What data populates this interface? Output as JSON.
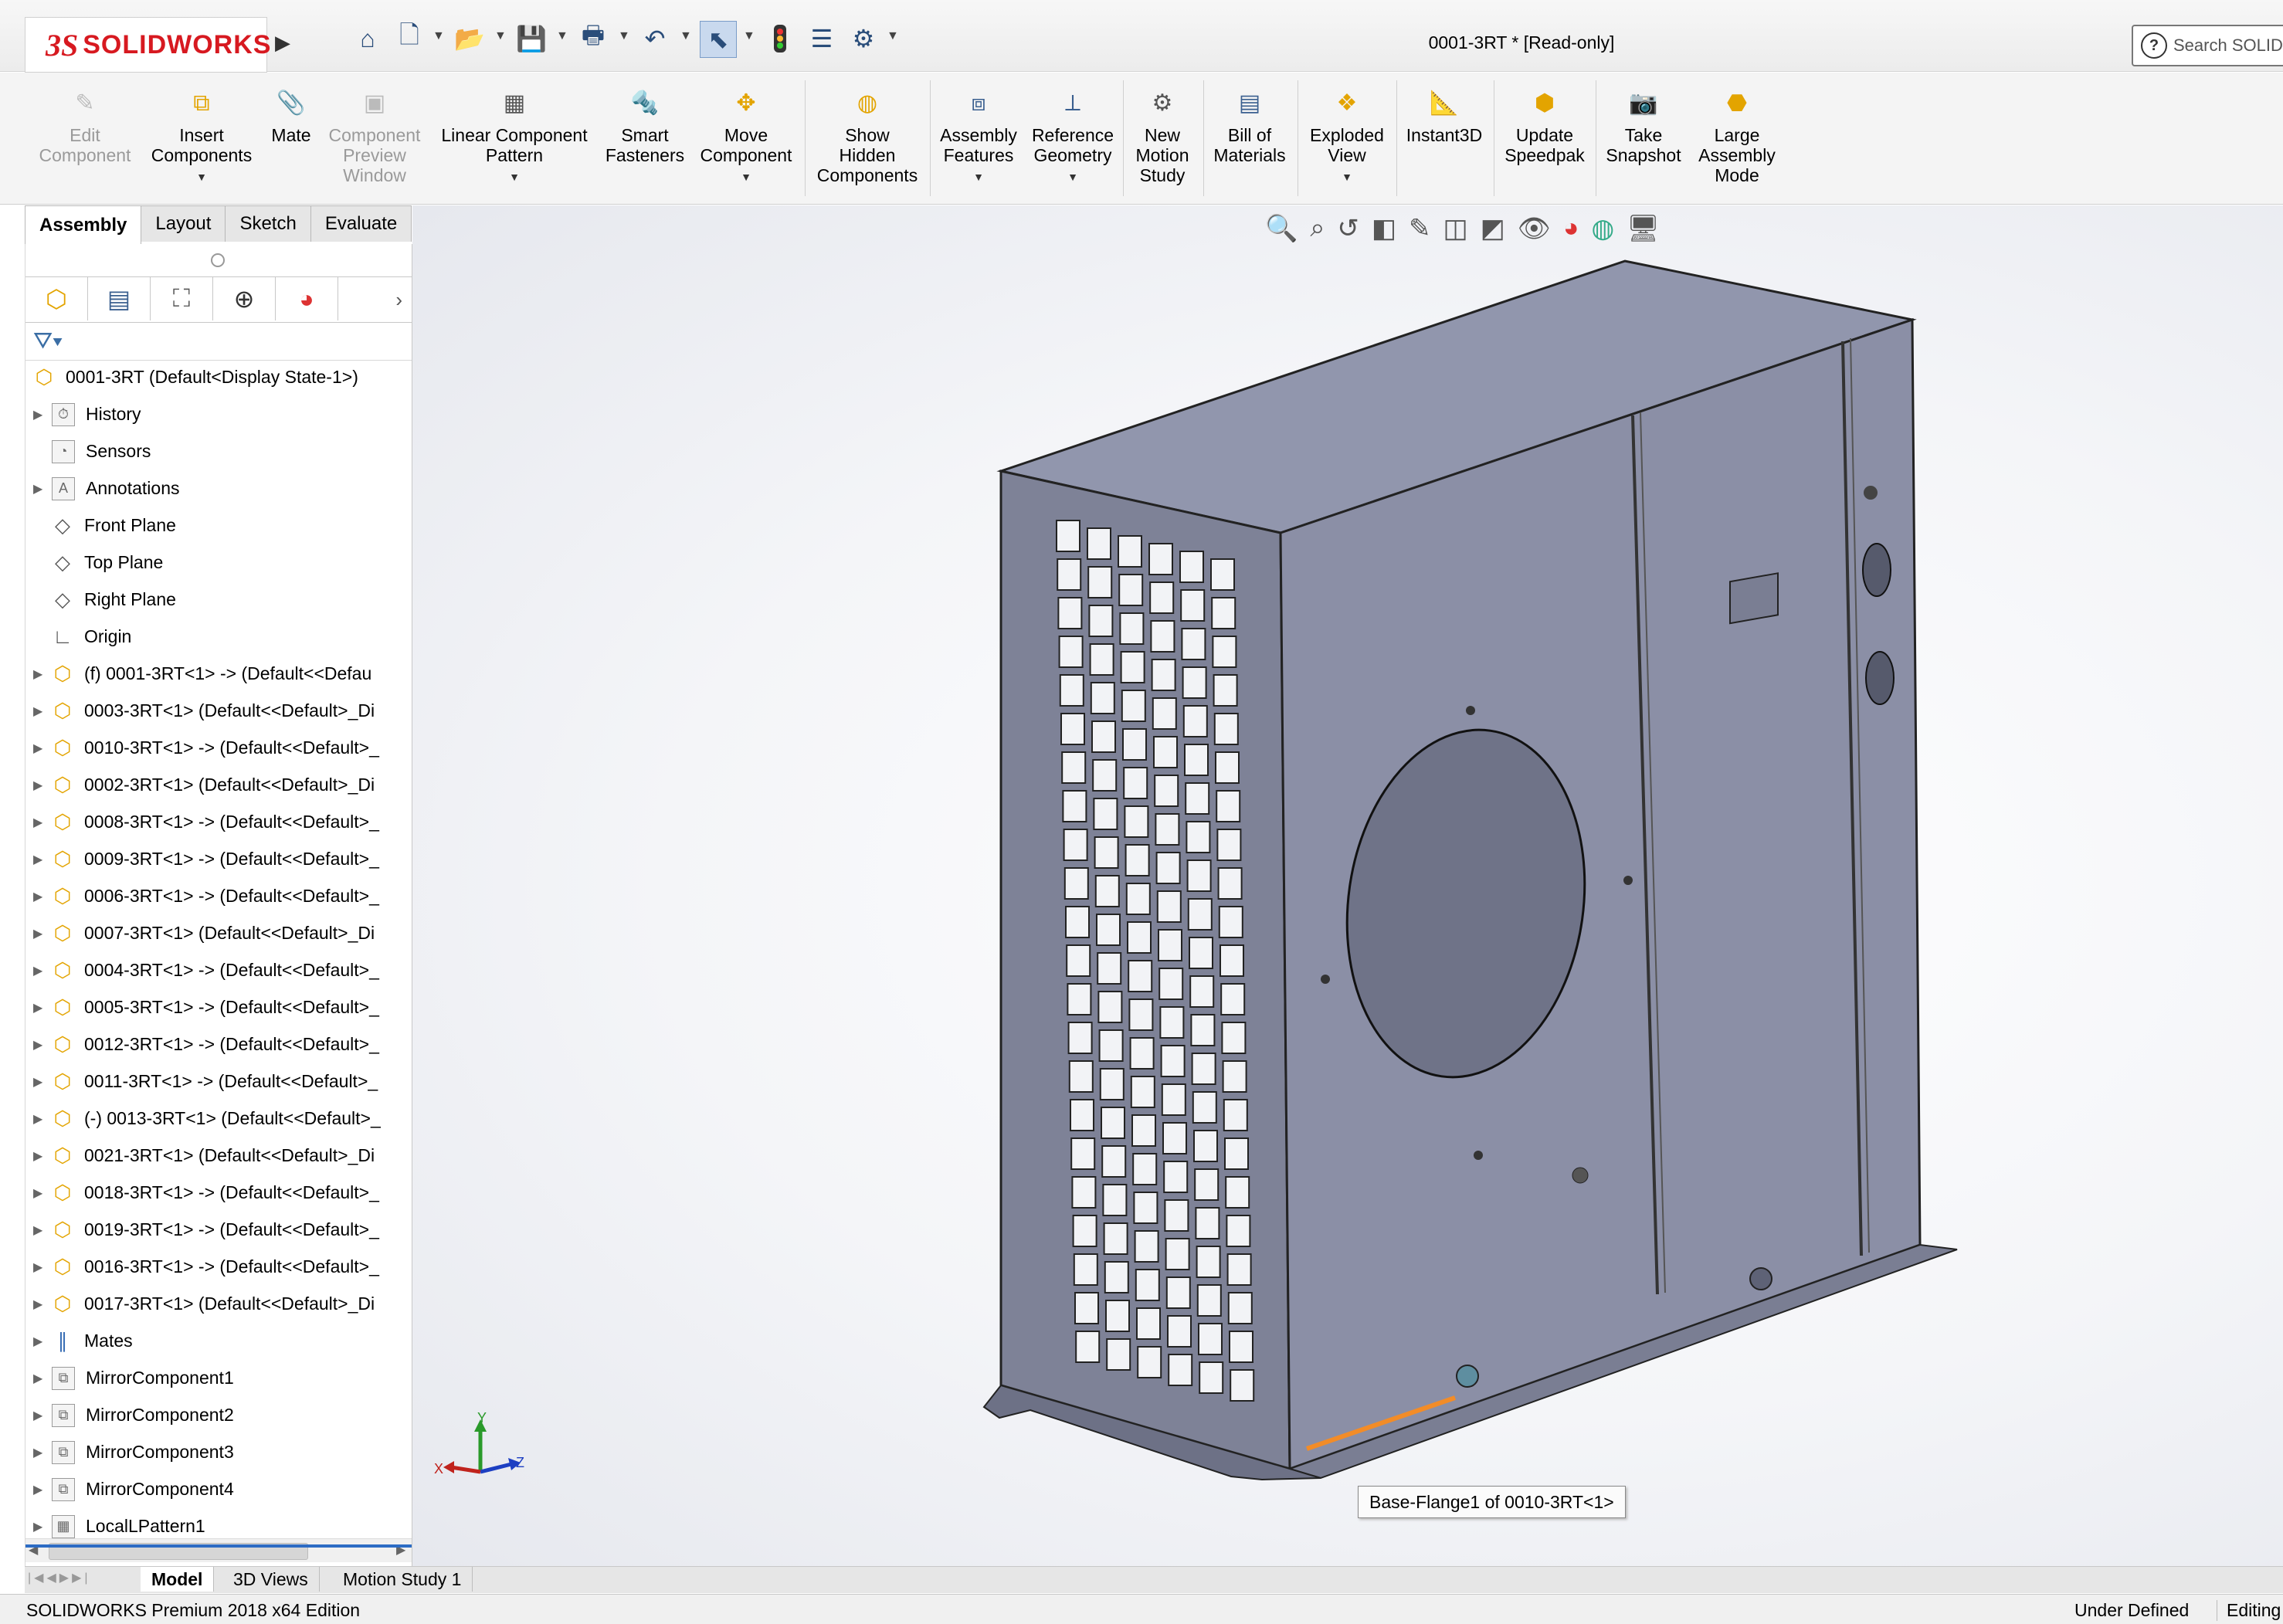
{
  "app": {
    "logo_text": "SOLIDWORKS",
    "document_title": "0001-3RT * [Read-only]",
    "search_placeholder": "Search SOLID"
  },
  "quick_access": [
    "home-icon",
    "new-document-icon",
    "open-icon",
    "save-icon",
    "print-icon",
    "undo-icon",
    "select-icon",
    "rebuild-icon",
    "file-properties-icon",
    "options-icon"
  ],
  "ribbon": [
    {
      "label": "Edit Component",
      "lines": [
        "Edit",
        "Component"
      ],
      "disabled": true
    },
    {
      "label": "Insert Components",
      "lines": [
        "Insert",
        "Components"
      ],
      "disabled": false,
      "dropdown": true
    },
    {
      "label": "Mate",
      "lines": [
        "Mate"
      ],
      "disabled": false
    },
    {
      "label": "Component Preview Window",
      "lines": [
        "Component",
        "Preview",
        "Window"
      ],
      "disabled": true
    },
    {
      "label": "Linear Component Pattern",
      "lines": [
        "Linear Component",
        "Pattern"
      ],
      "disabled": false,
      "dropdown": true
    },
    {
      "label": "Smart Fasteners",
      "lines": [
        "Smart",
        "Fasteners"
      ],
      "disabled": false
    },
    {
      "label": "Move Component",
      "lines": [
        "Move",
        "Component"
      ],
      "disabled": false,
      "dropdown": true
    },
    {
      "label": "Show Hidden Components",
      "lines": [
        "Show",
        "Hidden",
        "Components"
      ],
      "disabled": false
    },
    {
      "label": "Assembly Features",
      "lines": [
        "Assembly",
        "Features"
      ],
      "disabled": false,
      "dropdown": true
    },
    {
      "label": "Reference Geometry",
      "lines": [
        "Reference",
        "Geometry"
      ],
      "disabled": false,
      "dropdown": true
    },
    {
      "label": "New Motion Study",
      "lines": [
        "New",
        "Motion",
        "Study"
      ],
      "disabled": false
    },
    {
      "label": "Bill of Materials",
      "lines": [
        "Bill of",
        "Materials"
      ],
      "disabled": false
    },
    {
      "label": "Exploded View",
      "lines": [
        "Exploded",
        "View"
      ],
      "disabled": false,
      "dropdown": true
    },
    {
      "label": "Instant3D",
      "lines": [
        "Instant3D"
      ],
      "disabled": false
    },
    {
      "label": "Update Speedpak",
      "lines": [
        "Update",
        "Speedpak"
      ],
      "disabled": false
    },
    {
      "label": "Take Snapshot",
      "lines": [
        "Take",
        "Snapshot"
      ],
      "disabled": false
    },
    {
      "label": "Large Assembly Mode",
      "lines": [
        "Large",
        "Assembly",
        "Mode"
      ],
      "disabled": false
    }
  ],
  "command_tabs": [
    "Assembly",
    "Layout",
    "Sketch",
    "Evaluate"
  ],
  "active_command_tab": "Assembly",
  "tree": {
    "root": "0001-3RT  (Default<Display State-1>)",
    "items": [
      {
        "label": "History",
        "icon": "history-icon",
        "expand": true
      },
      {
        "label": "Sensors",
        "icon": "sensors-icon",
        "expand": false
      },
      {
        "label": "Annotations",
        "icon": "annotations-icon",
        "expand": true
      },
      {
        "label": "Front Plane",
        "icon": "plane-icon",
        "expand": false
      },
      {
        "label": "Top Plane",
        "icon": "plane-icon",
        "expand": false
      },
      {
        "label": "Right Plane",
        "icon": "plane-icon",
        "expand": false
      },
      {
        "label": "Origin",
        "icon": "origin-icon",
        "expand": false
      },
      {
        "label": "(f) 0001-3RT<1> -> (Default<<Defau",
        "icon": "part-icon",
        "expand": true
      },
      {
        "label": "0003-3RT<1> (Default<<Default>_Di",
        "icon": "part-icon",
        "expand": true
      },
      {
        "label": "0010-3RT<1> -> (Default<<Default>_",
        "icon": "part-icon",
        "expand": true
      },
      {
        "label": "0002-3RT<1> (Default<<Default>_Di",
        "icon": "part-icon",
        "expand": true
      },
      {
        "label": "0008-3RT<1> -> (Default<<Default>_",
        "icon": "part-icon",
        "expand": true
      },
      {
        "label": "0009-3RT<1> -> (Default<<Default>_",
        "icon": "part-icon",
        "expand": true
      },
      {
        "label": "0006-3RT<1> -> (Default<<Default>_",
        "icon": "part-icon",
        "expand": true
      },
      {
        "label": "0007-3RT<1> (Default<<Default>_Di",
        "icon": "part-icon",
        "expand": true
      },
      {
        "label": "0004-3RT<1> -> (Default<<Default>_",
        "icon": "part-icon",
        "expand": true
      },
      {
        "label": "0005-3RT<1> -> (Default<<Default>_",
        "icon": "part-icon",
        "expand": true
      },
      {
        "label": "0012-3RT<1> -> (Default<<Default>_",
        "icon": "part-icon",
        "expand": true
      },
      {
        "label": "0011-3RT<1> -> (Default<<Default>_",
        "icon": "part-icon",
        "expand": true
      },
      {
        "label": "(-) 0013-3RT<1> (Default<<Default>_",
        "icon": "part-icon",
        "expand": true
      },
      {
        "label": "0021-3RT<1> (Default<<Default>_Di",
        "icon": "part-icon",
        "expand": true
      },
      {
        "label": "0018-3RT<1> -> (Default<<Default>_",
        "icon": "part-icon",
        "expand": true
      },
      {
        "label": "0019-3RT<1> -> (Default<<Default>_",
        "icon": "part-icon",
        "expand": true
      },
      {
        "label": "0016-3RT<1> -> (Default<<Default>_",
        "icon": "part-icon",
        "expand": true
      },
      {
        "label": "0017-3RT<1> (Default<<Default>_Di",
        "icon": "part-icon",
        "expand": true
      },
      {
        "label": "Mates",
        "icon": "mates-icon",
        "expand": true
      },
      {
        "label": "MirrorComponent1",
        "icon": "mirror-component-icon",
        "expand": true
      },
      {
        "label": "MirrorComponent2",
        "icon": "mirror-component-icon",
        "expand": true
      },
      {
        "label": "MirrorComponent3",
        "icon": "mirror-component-icon",
        "expand": true
      },
      {
        "label": "MirrorComponent4",
        "icon": "mirror-component-icon",
        "expand": true
      },
      {
        "label": "LocalLPattern1",
        "icon": "pattern-icon",
        "expand": true
      }
    ]
  },
  "bottom_tabs": [
    "Model",
    "3D Views",
    "Motion Study 1"
  ],
  "active_bottom_tab": "Model",
  "status": {
    "left": "SOLIDWORKS Premium 2018 x64 Edition",
    "state": "Under Defined",
    "mode": "Editing"
  },
  "viewport": {
    "tooltip": "Base-Flange1 of 0010-3RT<1>",
    "triad_labels": {
      "x": "X",
      "y": "Y",
      "z": "Z"
    }
  },
  "colors": {
    "brand_red": "#d71920",
    "part_yellow": "#e3a400",
    "model_face": "#8b8fa6",
    "highlight_edge": "#f28c28",
    "selection_blue": "#2d6cc4"
  }
}
